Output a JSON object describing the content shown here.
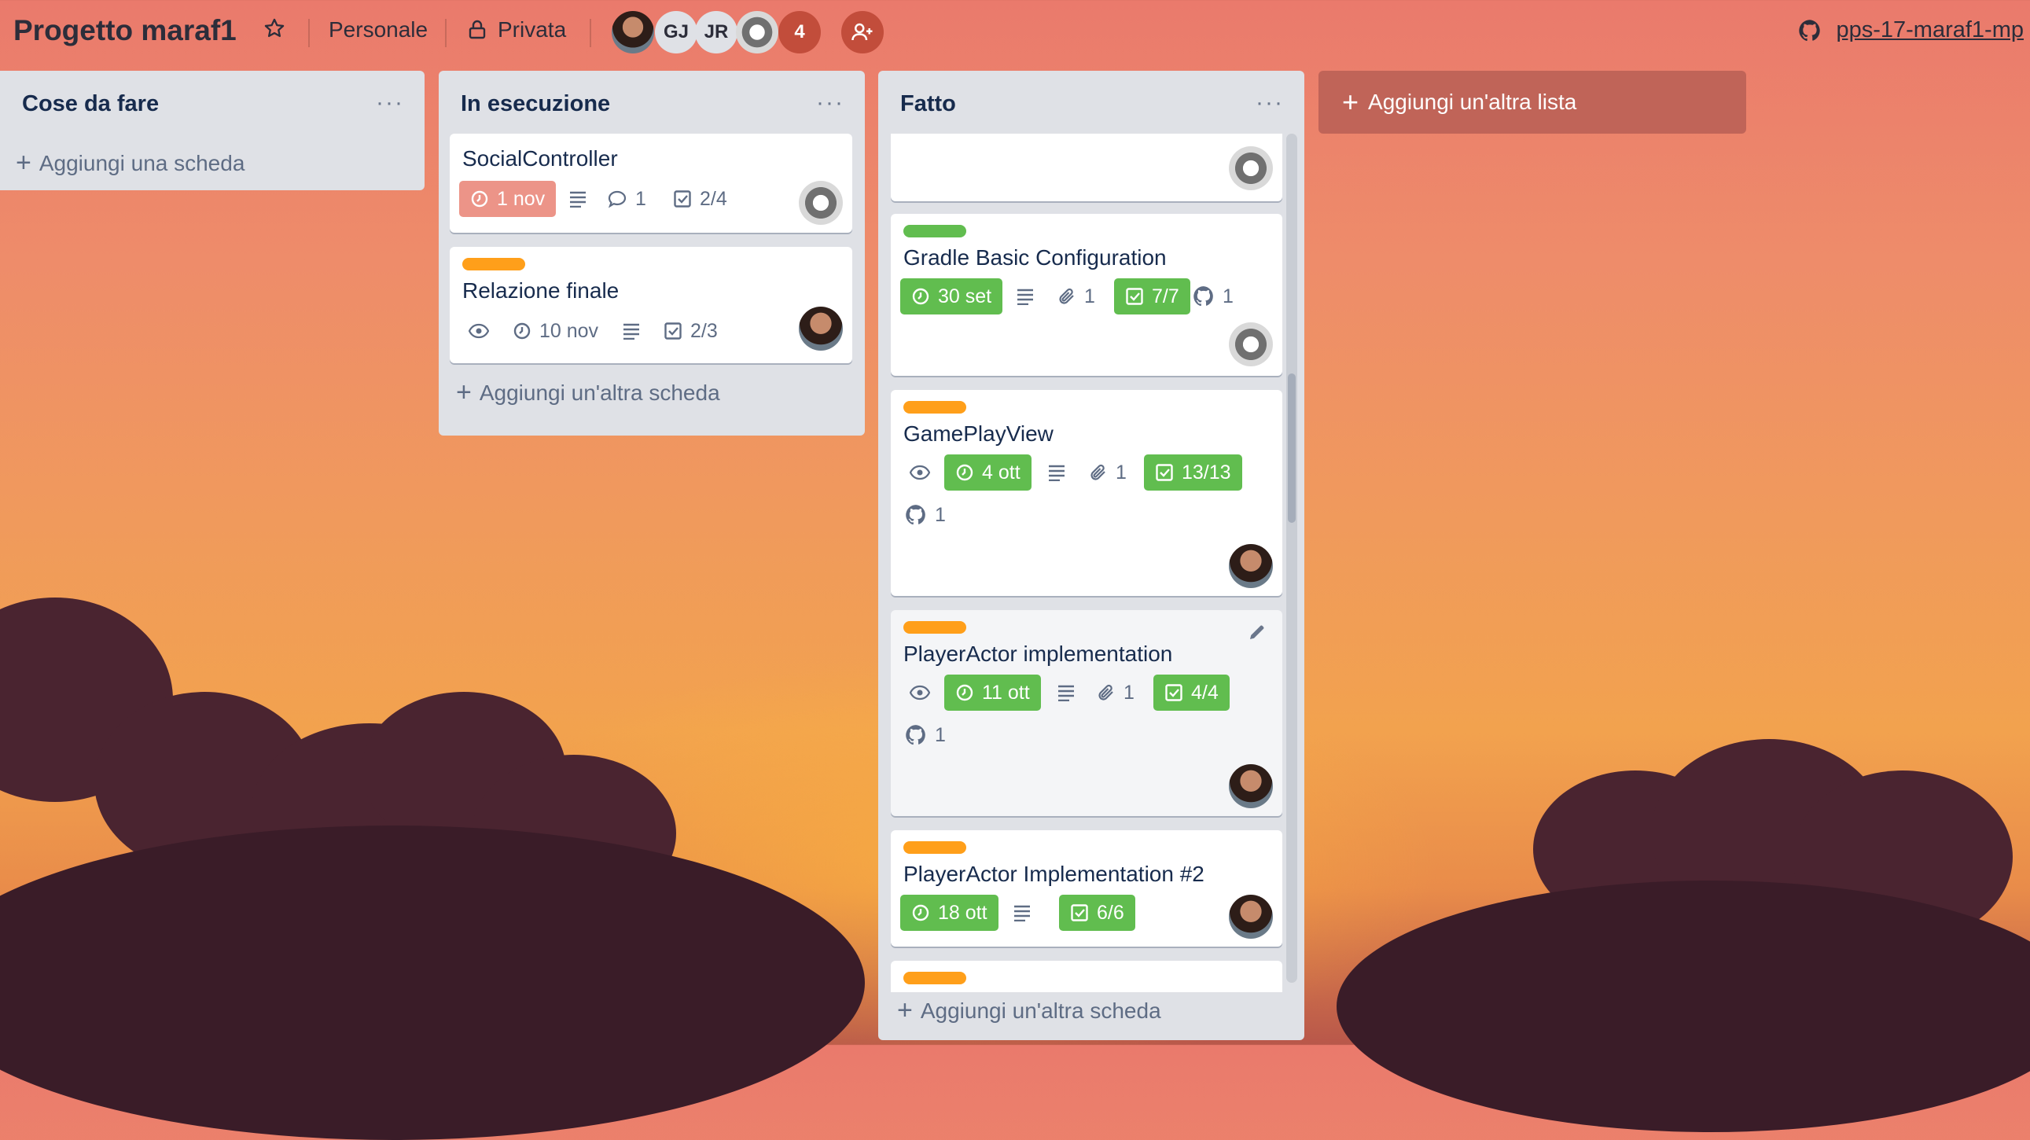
{
  "header": {
    "board_title": "Progetto maraf1",
    "team_label": "Personale",
    "visibility_label": "Privata",
    "members": [
      {
        "initials": "",
        "kind": "photo"
      },
      {
        "initials": "GJ",
        "kind": "initials"
      },
      {
        "initials": "JR",
        "kind": "initials"
      },
      {
        "initials": "",
        "kind": "air-force-logo"
      },
      {
        "initials": "4",
        "kind": "count"
      }
    ],
    "repo_link": "pps-17-maraf1-mp"
  },
  "lists": [
    {
      "title": "Cose da fare",
      "add_card_label": "Aggiungi una scheda",
      "cards": []
    },
    {
      "title": "In esecuzione",
      "add_card_label": "Aggiungi un'altra scheda",
      "cards": [
        {
          "title": "SocialController",
          "label_color": "",
          "due": "1 nov",
          "due_status": "overdue",
          "comments": "1",
          "checklist": "2/4"
        },
        {
          "title": "Relazione finale",
          "label_color": "#ff9f1a",
          "due": "10 nov",
          "due_status": "normal",
          "checklist": "2/3"
        }
      ]
    },
    {
      "title": "Fatto",
      "add_card_label": "Aggiungi un'altra scheda",
      "cards": [
        {
          "title": "",
          "label_color": ""
        },
        {
          "title": "Gradle Basic Configuration",
          "label_color": "#61bd4f",
          "due": "30 set",
          "due_status": "complete",
          "attachments": "1",
          "checklist": "7/7",
          "github": "1"
        },
        {
          "title": "GamePlayView",
          "label_color": "#ff9f1a",
          "due": "4 ott",
          "due_status": "complete",
          "attachments": "1",
          "checklist": "13/13",
          "github": "1"
        },
        {
          "title": "PlayerActor implementation",
          "label_color": "#ff9f1a",
          "due": "11 ott",
          "due_status": "complete",
          "attachments": "1",
          "checklist": "4/4",
          "github": "1"
        },
        {
          "title": "PlayerActor Implementation #2",
          "label_color": "#ff9f1a",
          "due": "18 ott",
          "due_status": "complete",
          "checklist": "6/6"
        }
      ]
    }
  ],
  "add_list_label": "Aggiungi un'altra lista",
  "colors": {
    "complete": "#61bd4f",
    "overdue": "#ec9488",
    "label_orange": "#ff9f1a",
    "label_green": "#61bd4f"
  }
}
